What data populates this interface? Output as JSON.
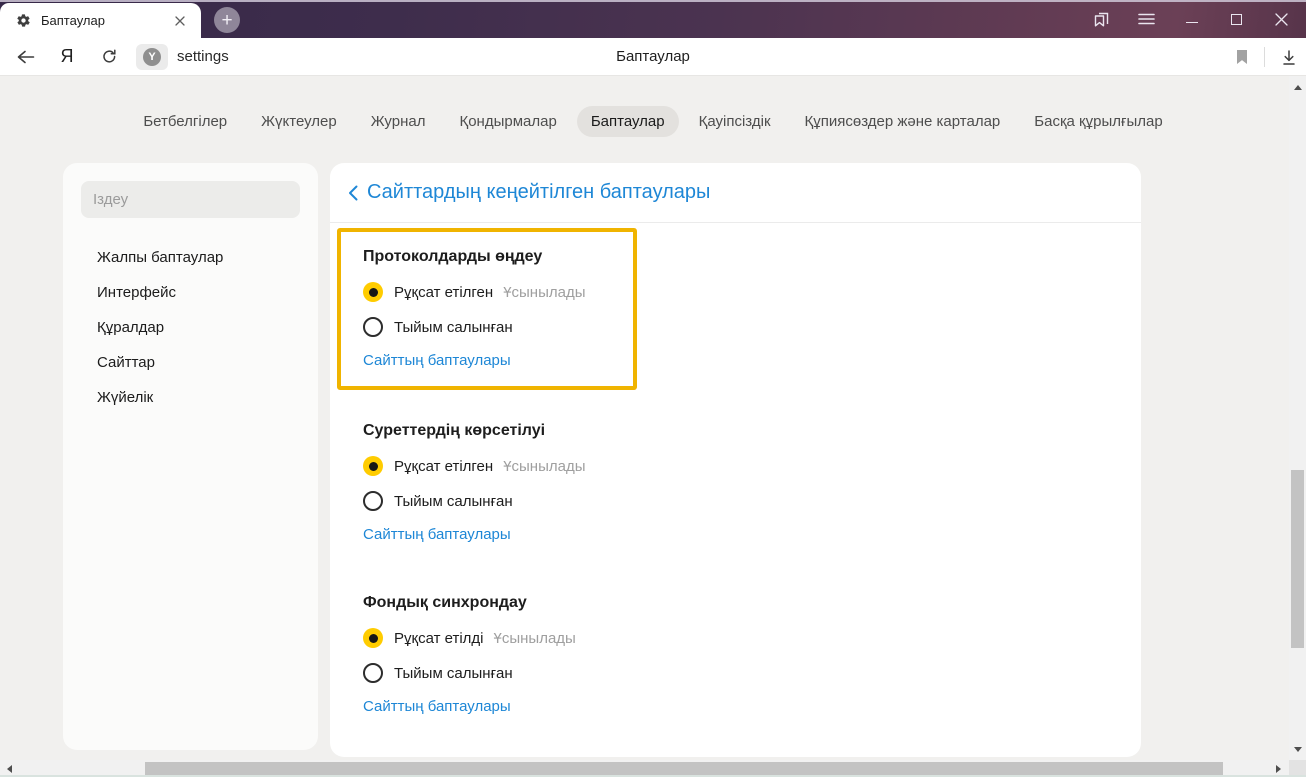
{
  "window": {
    "tab_title": "Баптаулар"
  },
  "icons": {
    "close": "×",
    "plus": "+"
  },
  "toolbar": {
    "yandex_logo": "Я",
    "protect_letter": "Y",
    "url_text": "settings",
    "page_title": "Баптаулар"
  },
  "nav_tabs": [
    {
      "label": "Бетбелгілер",
      "active": false
    },
    {
      "label": "Жүктеулер",
      "active": false
    },
    {
      "label": "Журнал",
      "active": false
    },
    {
      "label": "Қондырмалар",
      "active": false
    },
    {
      "label": "Баптаулар",
      "active": true
    },
    {
      "label": "Қауіпсіздік",
      "active": false
    },
    {
      "label": "Құпиясөздер және карталар",
      "active": false
    },
    {
      "label": "Басқа құрылғылар",
      "active": false
    }
  ],
  "sidebar": {
    "search_placeholder": "Іздеу",
    "items": [
      "Жалпы баптаулар",
      "Интерфейс",
      "Құралдар",
      "Сайттар",
      "Жүйелік"
    ]
  },
  "main": {
    "header_title": "Сайттардың кеңейтілген баптаулары",
    "sections": [
      {
        "title": "Протоколдарды өңдеу",
        "highlighted": true,
        "options": [
          {
            "label": "Рұқсат етілген",
            "selected": true,
            "badge": "Ұсынылады"
          },
          {
            "label": "Тыйым салынған",
            "selected": false
          }
        ],
        "link": "Сайттың баптаулары"
      },
      {
        "title": "Суреттердің көрсетілуі",
        "highlighted": false,
        "options": [
          {
            "label": "Рұқсат етілген",
            "selected": true,
            "badge": "Ұсынылады"
          },
          {
            "label": "Тыйым салынған",
            "selected": false
          }
        ],
        "link": "Сайттың баптаулары"
      },
      {
        "title": "Фондық синхрондау",
        "highlighted": false,
        "options": [
          {
            "label": "Рұқсат етілді",
            "selected": true,
            "badge": "Ұсынылады"
          },
          {
            "label": "Тыйым салынған",
            "selected": false
          }
        ],
        "link": "Сайттың баптаулары"
      }
    ]
  },
  "colors": {
    "accent_yellow": "#ffcc00",
    "highlight_border": "#f0b400",
    "link_blue": "#1e87d6",
    "page_bg": "#f1f0ee",
    "titlebar_left": "#362848",
    "titlebar_right": "#6b4056",
    "selected_pill_bg": "#e3e1de"
  }
}
